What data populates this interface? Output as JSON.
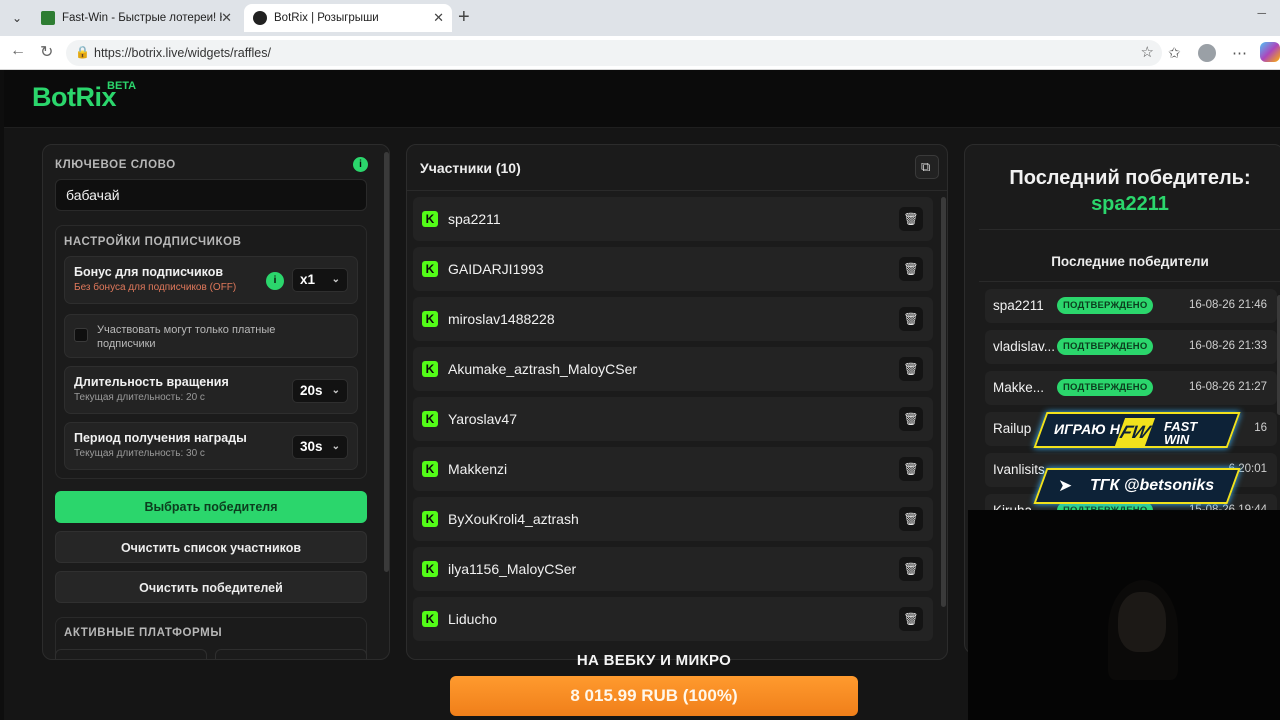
{
  "browser": {
    "tabs": [
      {
        "title": "Fast-Win - Быстрые лотереи! Ком"
      },
      {
        "title": "BotRix | Розыгрыши"
      }
    ],
    "url": "https://botrix.live/widgets/raffles/"
  },
  "app": {
    "logo": "BotRix",
    "logo_badge": "BETA"
  },
  "left": {
    "keyword_title": "КЛЮЧЕВОЕ СЛОВО",
    "keyword_value": "бабачай",
    "sub_settings_title": "НАСТРОЙКИ ПОДПИСЧИКОВ",
    "bonus_title": "Бонус для подписчиков",
    "bonus_sub": "Без бонуса для подписчиков (OFF)",
    "bonus_value": "x1",
    "paid_only_label": "Участвовать могут только платные подписчики",
    "spin_title": "Длительность вращения",
    "spin_sub": "Текущая длительность: 20 с",
    "spin_value": "20s",
    "claim_title": "Период получения награды",
    "claim_sub": "Текущая длительность: 30 с",
    "claim_value": "30s",
    "pick_winner": "Выбрать победителя",
    "clear_participants": "Очистить список участников",
    "clear_winners": "Очистить победителей",
    "platforms_title": "АКТИВНЫЕ ПЛАТФОРМЫ"
  },
  "participants": {
    "title": "Участники (10)",
    "list": [
      "spa2211",
      "GAIDARJI1993",
      "miroslav1488228",
      "Akumake_aztrash_MaloyCSer",
      "Yaroslav47",
      "Makkenzi",
      "ByXouKroli4_aztrash",
      "ilya1156_MaloyCSer",
      "Liducho"
    ]
  },
  "winners": {
    "last_title": "Последний победитель:",
    "last_name": "spa2211",
    "recent_title": "Последние победители",
    "list": [
      {
        "name": "spa2211",
        "status": "ПОДТВЕРЖДЕНО",
        "date": "16-08-26 21:46"
      },
      {
        "name": "vladislav...",
        "status": "ПОДТВЕРЖДЕНО",
        "date": "16-08-26 21:33"
      },
      {
        "name": "Makke...",
        "status": "ПОДТВЕРЖДЕНО",
        "date": "16-08-26 21:27"
      },
      {
        "name": "Railup",
        "status": "",
        "date": "16"
      },
      {
        "name": "Ivanlisits",
        "status": "",
        "date": "6 20:01"
      },
      {
        "name": "Kiruha",
        "status": "ПОДТВЕРЖДЕНО",
        "date": "15-08-26 19:44"
      }
    ]
  },
  "overlay": {
    "promo1_prefix": "ИГРАЮ НА",
    "promo1_logo": "FW",
    "promo1_brand_1": "FAST",
    "promo1_brand_2": "WIN",
    "promo2": "ТГК @betsoniks",
    "donation_title": "НА ВЕБКУ И МИКРО",
    "donation_amount": "8 015.99 RUB (100%)",
    "donation_progress": 1.0
  },
  "colors": {
    "accent": "#2bd66c",
    "kick": "#53fc18",
    "donation": "#f5891f"
  }
}
